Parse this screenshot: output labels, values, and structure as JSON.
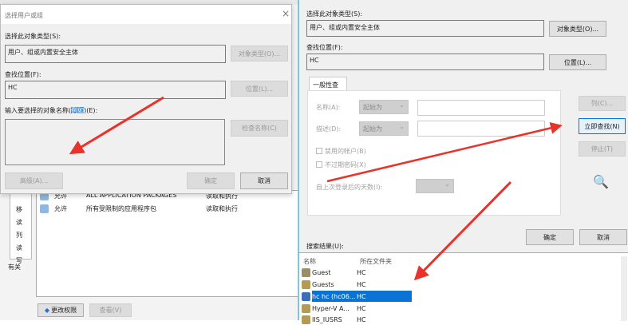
{
  "background_window": {
    "rows": [
      {
        "type": "允许",
        "name": "ALL APPLICATION PACKAGES",
        "access": "读取和执行"
      },
      {
        "type": "允许",
        "name": "所有受限制的应用程序包",
        "access": "读取和执行"
      }
    ],
    "side_chars": [
      "移",
      "读",
      "列",
      "读",
      "写"
    ],
    "about": "有关",
    "change_perm": "更改权限",
    "view": "查看(V)"
  },
  "left_dialog": {
    "title": "选择用户或组",
    "close": "×",
    "object_type_label": "选择此对象类型(S):",
    "object_type_value": "用户、组或内置安全主体",
    "object_type_btn": "对象类型(O)...",
    "location_label": "查找位置(F):",
    "location_value": "HC",
    "location_btn": "位置(L)...",
    "names_label_pre": "输入要选择的对象名称(",
    "names_label_link": "例如",
    "names_label_post": ")(E):",
    "check_names_btn": "检查名称(C)",
    "advanced_btn": "高级(A)...",
    "ok_btn": "确定",
    "cancel_btn": "取消"
  },
  "right_dialog": {
    "object_type_label": "选择此对象类型(S):",
    "object_type_value": "用户、组或内置安全主体",
    "object_type_btn": "对象类型(O)...",
    "location_label": "查找位置(F):",
    "location_value": "HC",
    "location_btn": "位置(L)...",
    "tab": "一般性查询",
    "name_label": "名称(A):",
    "name_mode": "起始为",
    "desc_label": "描述(D):",
    "desc_mode": "起始为",
    "disabled_accounts": "禁用的帐户(B)",
    "non_expiring": "不过期密码(X)",
    "days_label": "自上次登录后的天数(I):",
    "columns_btn": "列(C)...",
    "find_now_btn": "立即查找(N)",
    "stop_btn": "停止(T)",
    "ok_btn": "确定",
    "cancel_btn": "取消",
    "results_label": "搜索结果(U):",
    "col_name": "名称",
    "col_folder": "所在文件夹",
    "results": [
      {
        "name": "Guest",
        "folder": "HC"
      },
      {
        "name": "Guests",
        "folder": "HC"
      },
      {
        "name": "hc hc (hc06...",
        "folder": "HC",
        "selected": true
      },
      {
        "name": "Hyper-V A...",
        "folder": "HC"
      },
      {
        "name": "IIS_IUSRS",
        "folder": "HC"
      }
    ]
  },
  "colors": {
    "accent": "#0078d7",
    "arrow": "#e8322b"
  }
}
